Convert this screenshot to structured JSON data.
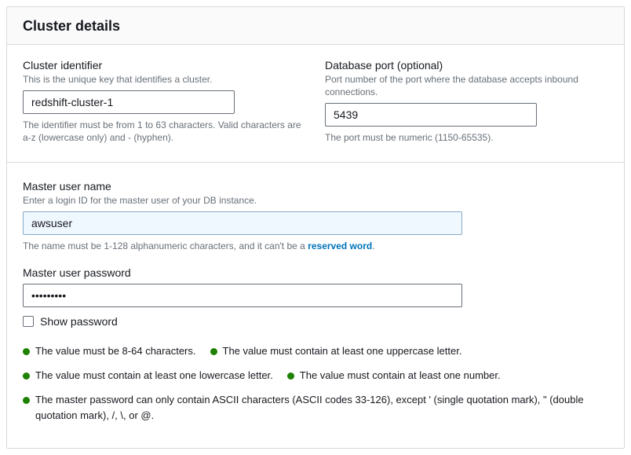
{
  "panel": {
    "title": "Cluster details"
  },
  "cluster_identifier": {
    "label": "Cluster identifier",
    "desc": "This is the unique key that identifies a cluster.",
    "value": "redshift-cluster-1",
    "hint": "The identifier must be from 1 to 63 characters. Valid characters are a-z (lowercase only) and - (hyphen)."
  },
  "database_port": {
    "label": "Database port (optional)",
    "desc": "Port number of the port where the database accepts inbound connections.",
    "value": "5439",
    "hint": "The port must be numeric (1150-65535)."
  },
  "master_user_name": {
    "label": "Master user name",
    "desc": "Enter a login ID for the master user of your DB instance.",
    "value": "awsuser",
    "hint_pre": "The name must be 1-128 alphanumeric characters, and it can't be a ",
    "hint_link": "reserved word",
    "hint_post": "."
  },
  "master_user_password": {
    "label": "Master user password",
    "value": "•••••••••",
    "show_password_label": "Show password"
  },
  "rules": {
    "r1": "The value must be 8-64 characters.",
    "r2": "The value must contain at least one uppercase letter.",
    "r3": "The value must contain at least one lowercase letter.",
    "r4": "The value must contain at least one number.",
    "r5": "The master password can only contain ASCII characters (ASCII codes 33-126), except ' (single quotation mark), \" (double quotation mark), /, \\, or @."
  }
}
